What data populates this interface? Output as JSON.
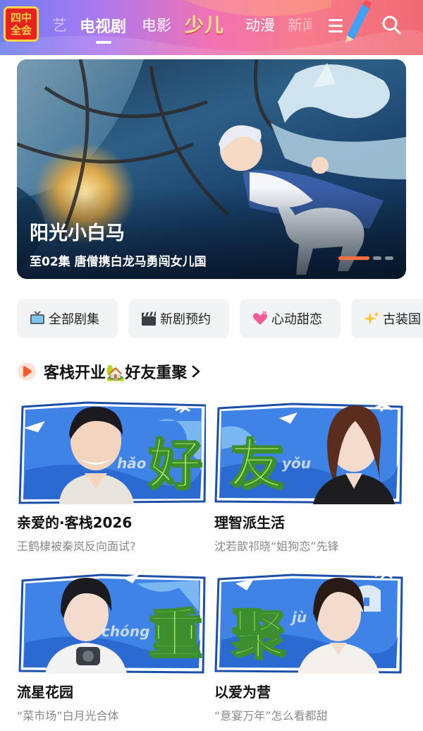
{
  "header": {
    "logo_line1": "四中",
    "logo_line2": "全会",
    "tabs": [
      {
        "label": "艺",
        "state": "dim"
      },
      {
        "label": "电视剧",
        "state": "active"
      },
      {
        "label": "电影",
        "state": "normal"
      },
      {
        "label": "少儿",
        "state": "special"
      },
      {
        "label": "动漫",
        "state": "normal"
      },
      {
        "label": "新闻",
        "state": "partial"
      }
    ],
    "icons": [
      "menu-icon",
      "search-icon"
    ]
  },
  "banner": {
    "title": "阳光小白马",
    "subtitle": "至02集 唐僧携白龙马勇闯女儿国",
    "carousel_index": 1,
    "carousel_total": 3
  },
  "chips": [
    {
      "label": "全部剧集",
      "icon": "tv-icon"
    },
    {
      "label": "新剧预约",
      "icon": "clapperboard-icon"
    },
    {
      "label": "心动甜恋",
      "icon": "hearts-icon"
    },
    {
      "label": "古装国",
      "icon": "sparkles-icon"
    }
  ],
  "section": {
    "title": "客栈开业🏡好友重聚"
  },
  "cards": [
    {
      "title": "亲爱的·客栈2026",
      "subtitle": "王鹤棣被秦岚反向面试?",
      "poster_char": "好",
      "poster_pinyin": "hǎo"
    },
    {
      "title": "理智派生活",
      "subtitle": "沈若歆祁晓“姐狗恋”先锋",
      "poster_char": "友",
      "poster_pinyin": "yǒu"
    },
    {
      "title": "流星花园",
      "subtitle": "“菜市场”白月光合体",
      "poster_char": "重",
      "poster_pinyin": "chóng"
    },
    {
      "title": "以爱为营",
      "subtitle": "“意宴万年”怎么看都甜",
      "poster_char": "聚",
      "poster_pinyin": "jù"
    }
  ],
  "colors": {
    "accent": "#ff6f3c",
    "poster_bg": "#3f83e6",
    "poster_char": "#b7f26a"
  }
}
